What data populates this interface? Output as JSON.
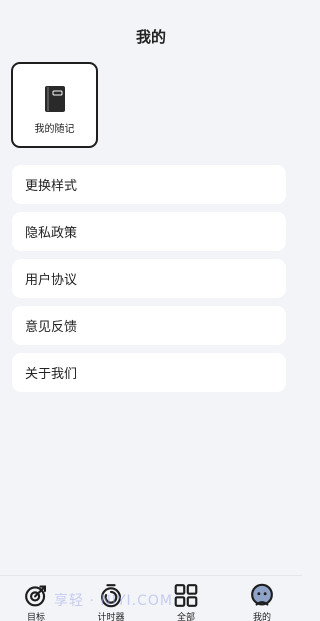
{
  "header": {
    "title": "我的"
  },
  "notes_card": {
    "label": "我的随记",
    "icon": "notebook-icon"
  },
  "menu": {
    "items": [
      {
        "label": "更换样式"
      },
      {
        "label": "隐私政策"
      },
      {
        "label": "用户协议"
      },
      {
        "label": "意见反馈"
      },
      {
        "label": "关于我们"
      }
    ]
  },
  "tabbar": {
    "tabs": [
      {
        "label": "目标",
        "icon": "target-icon"
      },
      {
        "label": "计时器",
        "icon": "timer-icon"
      },
      {
        "label": "全部",
        "icon": "grid-icon"
      },
      {
        "label": "我的",
        "icon": "profile-icon",
        "active": true
      }
    ]
  },
  "watermark": {
    "text": "享轻 · NIYI.COM"
  },
  "colors": {
    "background": "#f3f4f8",
    "card": "#ffffff",
    "text": "#222222",
    "border": "#1e1e1e"
  }
}
